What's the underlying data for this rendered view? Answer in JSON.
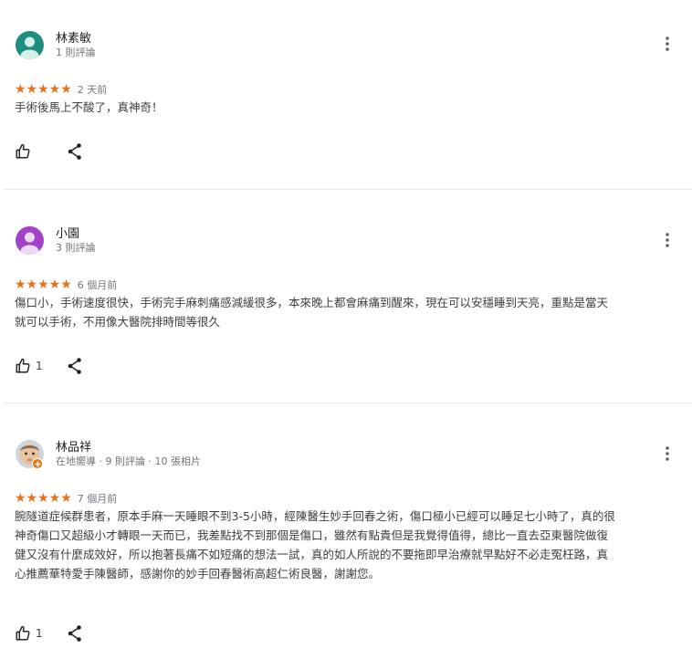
{
  "colors": {
    "star": "#e7711b",
    "meta_text": "#70757a",
    "body_text": "#3c4043",
    "divider": "#e8eaed",
    "avatar_1": "#1e8e7e",
    "avatar_2": "#a142c9",
    "local_guide_badge": "#e8710a"
  },
  "reviews": [
    {
      "author": "林素敏",
      "meta": "1 則評論",
      "rating": 5,
      "stars": "★★★★★",
      "date": "2 天前",
      "text": "手術後馬上不酸了，真神奇！",
      "likes": "",
      "avatar_icon": "person-silhouette"
    },
    {
      "author": "小園",
      "meta": "3 則評論",
      "rating": 5,
      "stars": "★★★★★",
      "date": "6 個月前",
      "text": "傷口小，手術速度很快，手術完手麻刺痛感減緩很多，本來晚上都會麻痛到醒來，現在可以安穩睡到天亮，重點是當天就可以手術，不用像大醫院排時間等很久",
      "likes": "1",
      "avatar_icon": "person-silhouette"
    },
    {
      "author": "林品祥",
      "meta": "在地嚮導 · 9 則評論 · 10 張相片",
      "rating": 5,
      "stars": "★★★★★",
      "date": "7 個月前",
      "text": "腕隧道症候群患者，原本手麻一天睡眼不到3-5小時，經陳醫生妙手回春之術，傷口極小已經可以睡足七小時了，真的很神奇傷口又超級小才轉眼一天而已，我差點找不到那個是傷口，雖然有點貴但是我覺得值得，總比一直去亞東醫院做復健又沒有什麼成效好，所以抱著長痛不如短痛的想法一試，真的如人所說的不要拖即早治療就早點好不必走冤枉路，真心推薦華特愛手陳醫師，感謝你的妙手回春醫術高超仁術良醫，謝謝您。",
      "likes": "1",
      "avatar_icon": "baby-photo"
    }
  ],
  "icons": {
    "more": "more-vert-icon",
    "like": "thumb-up-icon",
    "share": "share-icon"
  }
}
